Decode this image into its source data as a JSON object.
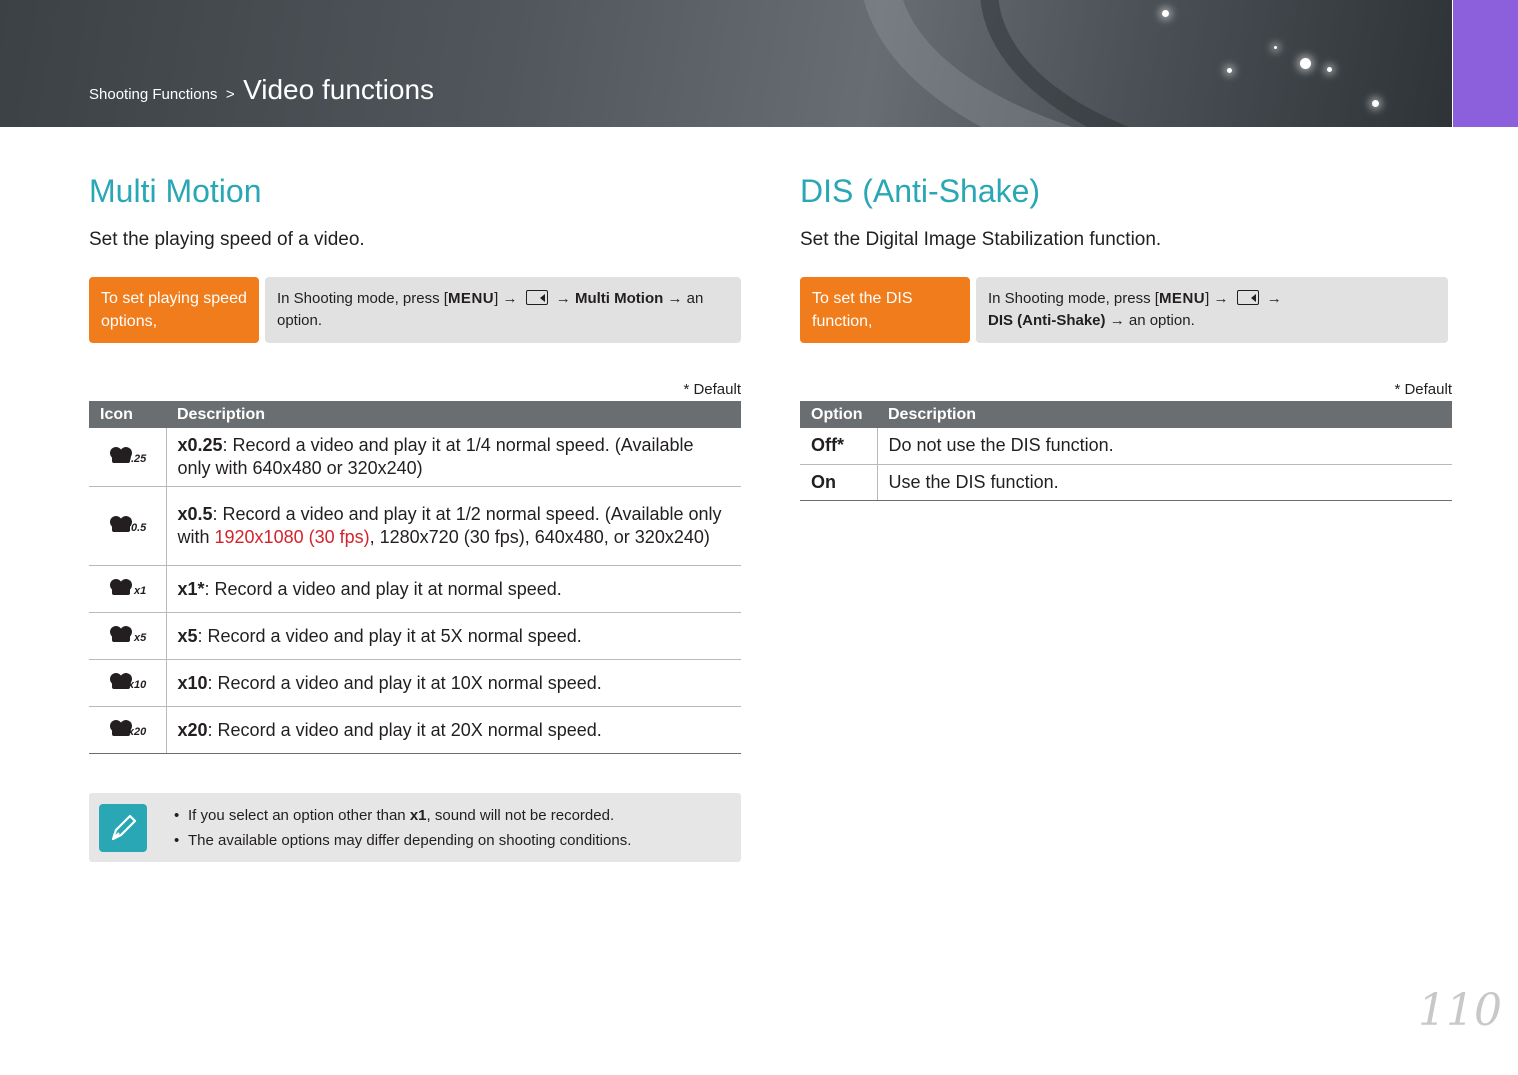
{
  "header": {
    "breadcrumb_parent": "Shooting Functions",
    "breadcrumb_separator": ">",
    "breadcrumb_current": "Video functions",
    "accent_color": "#8c5fdc"
  },
  "left": {
    "title": "Multi Motion",
    "description": "Set the playing speed of a video.",
    "howto_label": "To set playing speed options,",
    "howto_prefix": "In Shooting mode, press [",
    "menu_key": "MENU",
    "howto_mid": "] →",
    "howto_arrow2": "→",
    "howto_bold": "Multi Motion",
    "howto_suffix": "→ an option.",
    "default_note": "* Default",
    "table_headers": [
      "Icon",
      "Description"
    ],
    "rows": [
      {
        "icon": "x0.25-motion-icon",
        "speed": "x0.25",
        "name": "x0.25",
        "text": ": Record a video and play it at 1/4 normal speed. (Available only with 640x480 or 320x240)"
      },
      {
        "icon": "x0.5-motion-icon",
        "speed": "x0.5",
        "name": "x0.5",
        "text_pre": ": Record a video and play it at 1/2 normal speed. (Available only with ",
        "highlight": "1920x1080 (30 fps)",
        "text_post": ", 1280x720 (30 fps), 640x480, or 320x240)"
      },
      {
        "icon": "x1-motion-icon",
        "speed": "x1",
        "name": "x1*",
        "text": ": Record a video and play it at normal speed."
      },
      {
        "icon": "x5-motion-icon",
        "speed": "x5",
        "name": "x5",
        "text": ": Record a video and play it at 5X normal speed."
      },
      {
        "icon": "x10-motion-icon",
        "speed": "x10",
        "name": "x10",
        "text": ": Record a video and play it at 10X normal speed."
      },
      {
        "icon": "x20-motion-icon",
        "speed": "x20",
        "name": "x20",
        "text": ": Record a video and play it at 20X normal speed."
      }
    ]
  },
  "right": {
    "title": "DIS (Anti-Shake)",
    "description": "Set the Digital Image Stabilization function.",
    "howto_label": "To set the DIS function,",
    "howto_prefix": "In Shooting mode, press [",
    "menu_key": "MENU",
    "howto_mid": "] →",
    "howto_arrow2": "→",
    "howto_bold": "DIS (Anti-Shake)",
    "howto_suffix": "→ an option.",
    "default_note": "* Default",
    "table_headers": [
      "Option",
      "Description"
    ],
    "rows": [
      {
        "option": "Off*",
        "description": "Do not use the DIS function."
      },
      {
        "option": "On",
        "description": "Use the DIS function."
      }
    ]
  },
  "note": {
    "icon": "pen-icon",
    "item1_pre": "If you select an option other than ",
    "item1_bold": "x1",
    "item1_post": ", sound will not be recorded.",
    "item2": "The available options may differ depending on shooting conditions."
  },
  "page_number": "110",
  "colors": {
    "title": "#2aa7b5",
    "label": "#f07c1b",
    "highlight": "#d3242b"
  }
}
